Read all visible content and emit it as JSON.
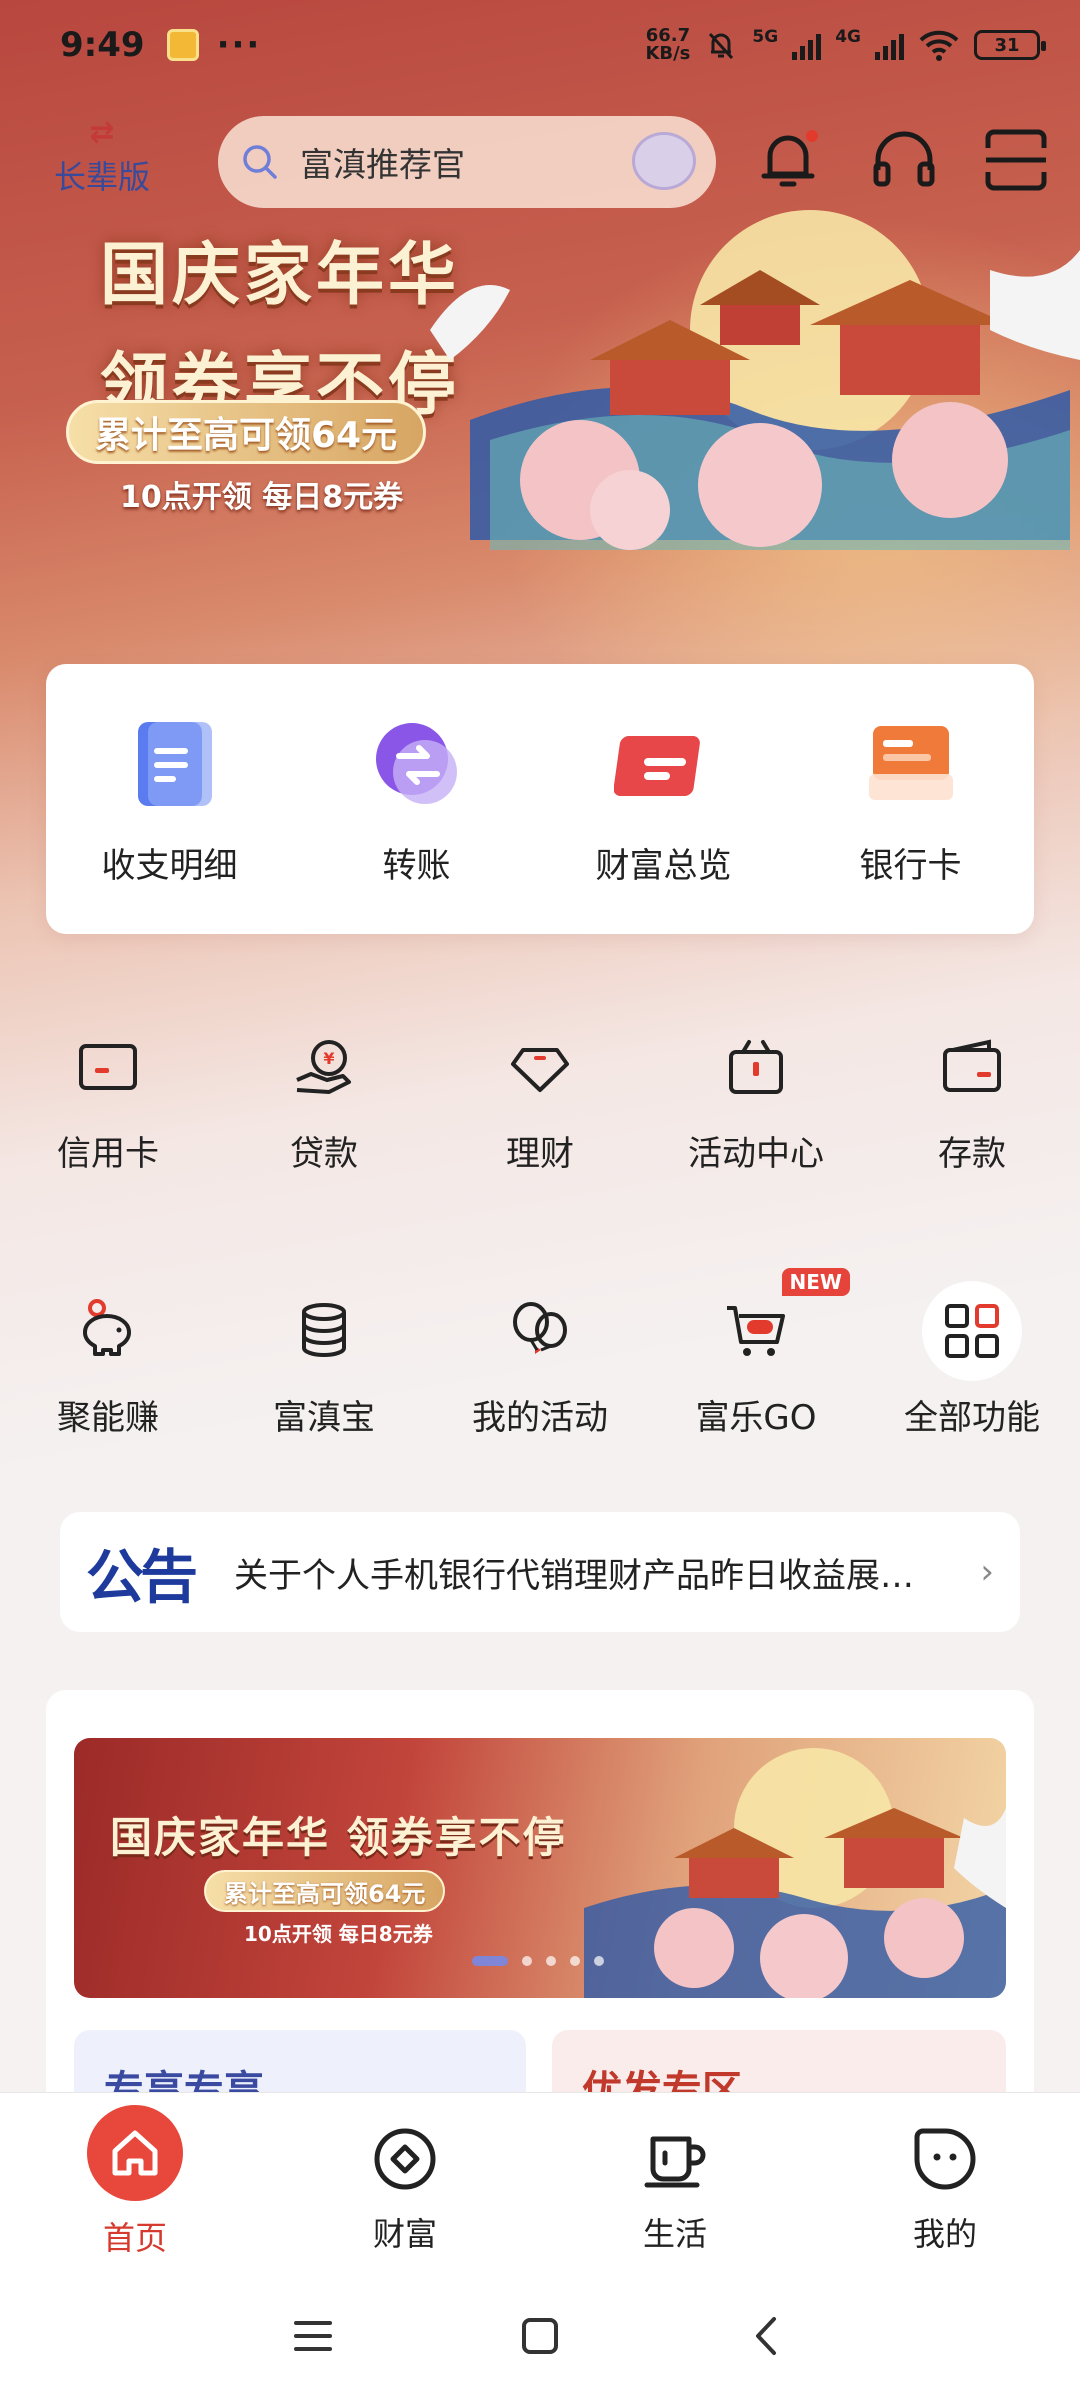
{
  "status_bar": {
    "time": "9:49",
    "more": "···",
    "net_speed_value": "66.7",
    "net_speed_unit": "KB/s",
    "sig1_label": "5G",
    "sig2_label": "4G",
    "battery": "31"
  },
  "header": {
    "elder_mode_label": "长辈版",
    "search_placeholder": "富滇推荐官"
  },
  "banner": {
    "title_line1": "国庆家年华",
    "title_line2": "领券享不停",
    "pill": "累计至高可领64元",
    "sub": "10点开领 每日8元券"
  },
  "quick_actions": [
    {
      "label": "收支明细",
      "icon": "statement-icon",
      "color": "#5b7cf0"
    },
    {
      "label": "转账",
      "icon": "transfer-icon",
      "color": "#8a56e8"
    },
    {
      "label": "财富总览",
      "icon": "wealth-overview-icon",
      "color": "#e8474a"
    },
    {
      "label": "银行卡",
      "icon": "bank-card-icon",
      "color": "#f07a3a"
    }
  ],
  "grid_row1": [
    {
      "label": "信用卡",
      "icon": "credit-card-icon"
    },
    {
      "label": "贷款",
      "icon": "loan-icon"
    },
    {
      "label": "理财",
      "icon": "diamond-icon"
    },
    {
      "label": "活动中心",
      "icon": "gift-icon"
    },
    {
      "label": "存款",
      "icon": "wallet-icon"
    }
  ],
  "grid_row2": [
    {
      "label": "聚能赚",
      "icon": "piggy-bank-icon"
    },
    {
      "label": "富滇宝",
      "icon": "coins-icon"
    },
    {
      "label": "我的活动",
      "icon": "balloon-icon"
    },
    {
      "label": "富乐GO",
      "icon": "shopping-cart-icon",
      "badge": "NEW"
    },
    {
      "label": "全部功能",
      "icon": "grid-icon"
    }
  ],
  "notice": {
    "logo": "公告",
    "text": "关于个人手机银行代销理财产品昨日收益展…"
  },
  "promo": {
    "title": "国庆家年华 领券享不停",
    "pill": "累计至高可领64元",
    "sub": "10点开领 每日8元券",
    "slide_count": 5,
    "active_slide": 1
  },
  "sub_cards": {
    "left_title": "专享专享",
    "right_title": "优发专区"
  },
  "bottom_nav": [
    {
      "label": "首页",
      "icon": "home-icon",
      "active": true
    },
    {
      "label": "财富",
      "icon": "wealth-icon",
      "active": false
    },
    {
      "label": "生活",
      "icon": "coffee-cup-icon",
      "active": false
    },
    {
      "label": "我的",
      "icon": "profile-face-icon",
      "active": false
    }
  ],
  "colors": {
    "accent": "#d63a2f",
    "notice_blue": "#1d3a9c",
    "badge_red": "#e6443a"
  }
}
